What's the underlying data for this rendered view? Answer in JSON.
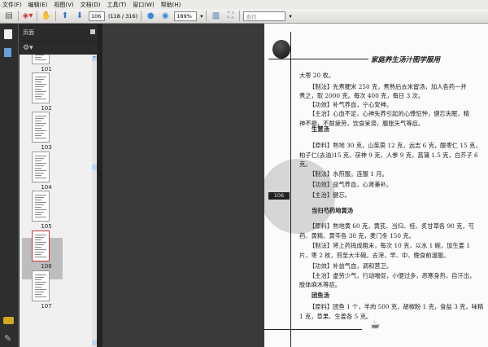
{
  "menu": [
    "文件(F)",
    "编辑(E)",
    "视图(V)",
    "文档(D)",
    "工具(T)",
    "窗口(W)",
    "帮助(H)"
  ],
  "toolbar": {
    "page_input": "106",
    "page_count": "(118 / 316)",
    "zoom": "189%",
    "search_placeholder": "查找"
  },
  "panel": {
    "title": "页面",
    "thumbnails": [
      "101",
      "102",
      "103",
      "104",
      "105",
      "106",
      "107"
    ],
    "selected": "106"
  },
  "document": {
    "header": "家庭养生汤汁图学服用",
    "page_number": "106",
    "lines": [
      "大枣 20 枚。",
      "【制法】先煮粳米 250 克，煮熟后去米留汤，加人各药一并",
      "煮之，取 2000 克。每次 400 克，每日 3 次。",
      "【功效】补气养血，宁心安神。",
      "【主治】心血不足，心神失养引起的心悸怔忡，健忘失眠，精",
      "神不振，不耐疲劳，饮食呆滞，腹胀矢气等症。",
      "【原料】熟地 30 克，山茱萸 12 克，远志 6 克，酸枣仁 15 克，",
      "柏子仁(去油)15 克，茯神 9 克，人参 9 克，菖蒲 1.5 克，白芥子 6",
      "克。",
      "【制法】水煎服。连服 1 月。",
      "【功效】益气养血，心肾兼补。",
      "【主治】健忘。",
      "【原料】熟地黄 60 克，黄芪、当归、桂、炙甘草各 90 克，芍",
      "药、黄精、黄芩各 30 克，麦门冬 150 克。",
      "【制法】将上药捣成粗末，每次 10 克，以水 1 碗，加生姜 1",
      "片，枣 2 枚，煎至大半碗。去滓，早、中、晚食前温服。",
      "【功效】补益气血，调和营卫。",
      "【主治】虚劳少气，行动喘促，小便过多，恶寒身热，自汗出，",
      "肢体麻木等症。",
      "【原料】团鱼 1 个，羊肉 500 克，胡椒粉 1 克，食盐 3 克，味精",
      "1 克，草果、生姜各 5 克。"
    ],
    "titles": [
      "生慧汤",
      "当归芍药地黄汤",
      "团鱼汤"
    ]
  }
}
